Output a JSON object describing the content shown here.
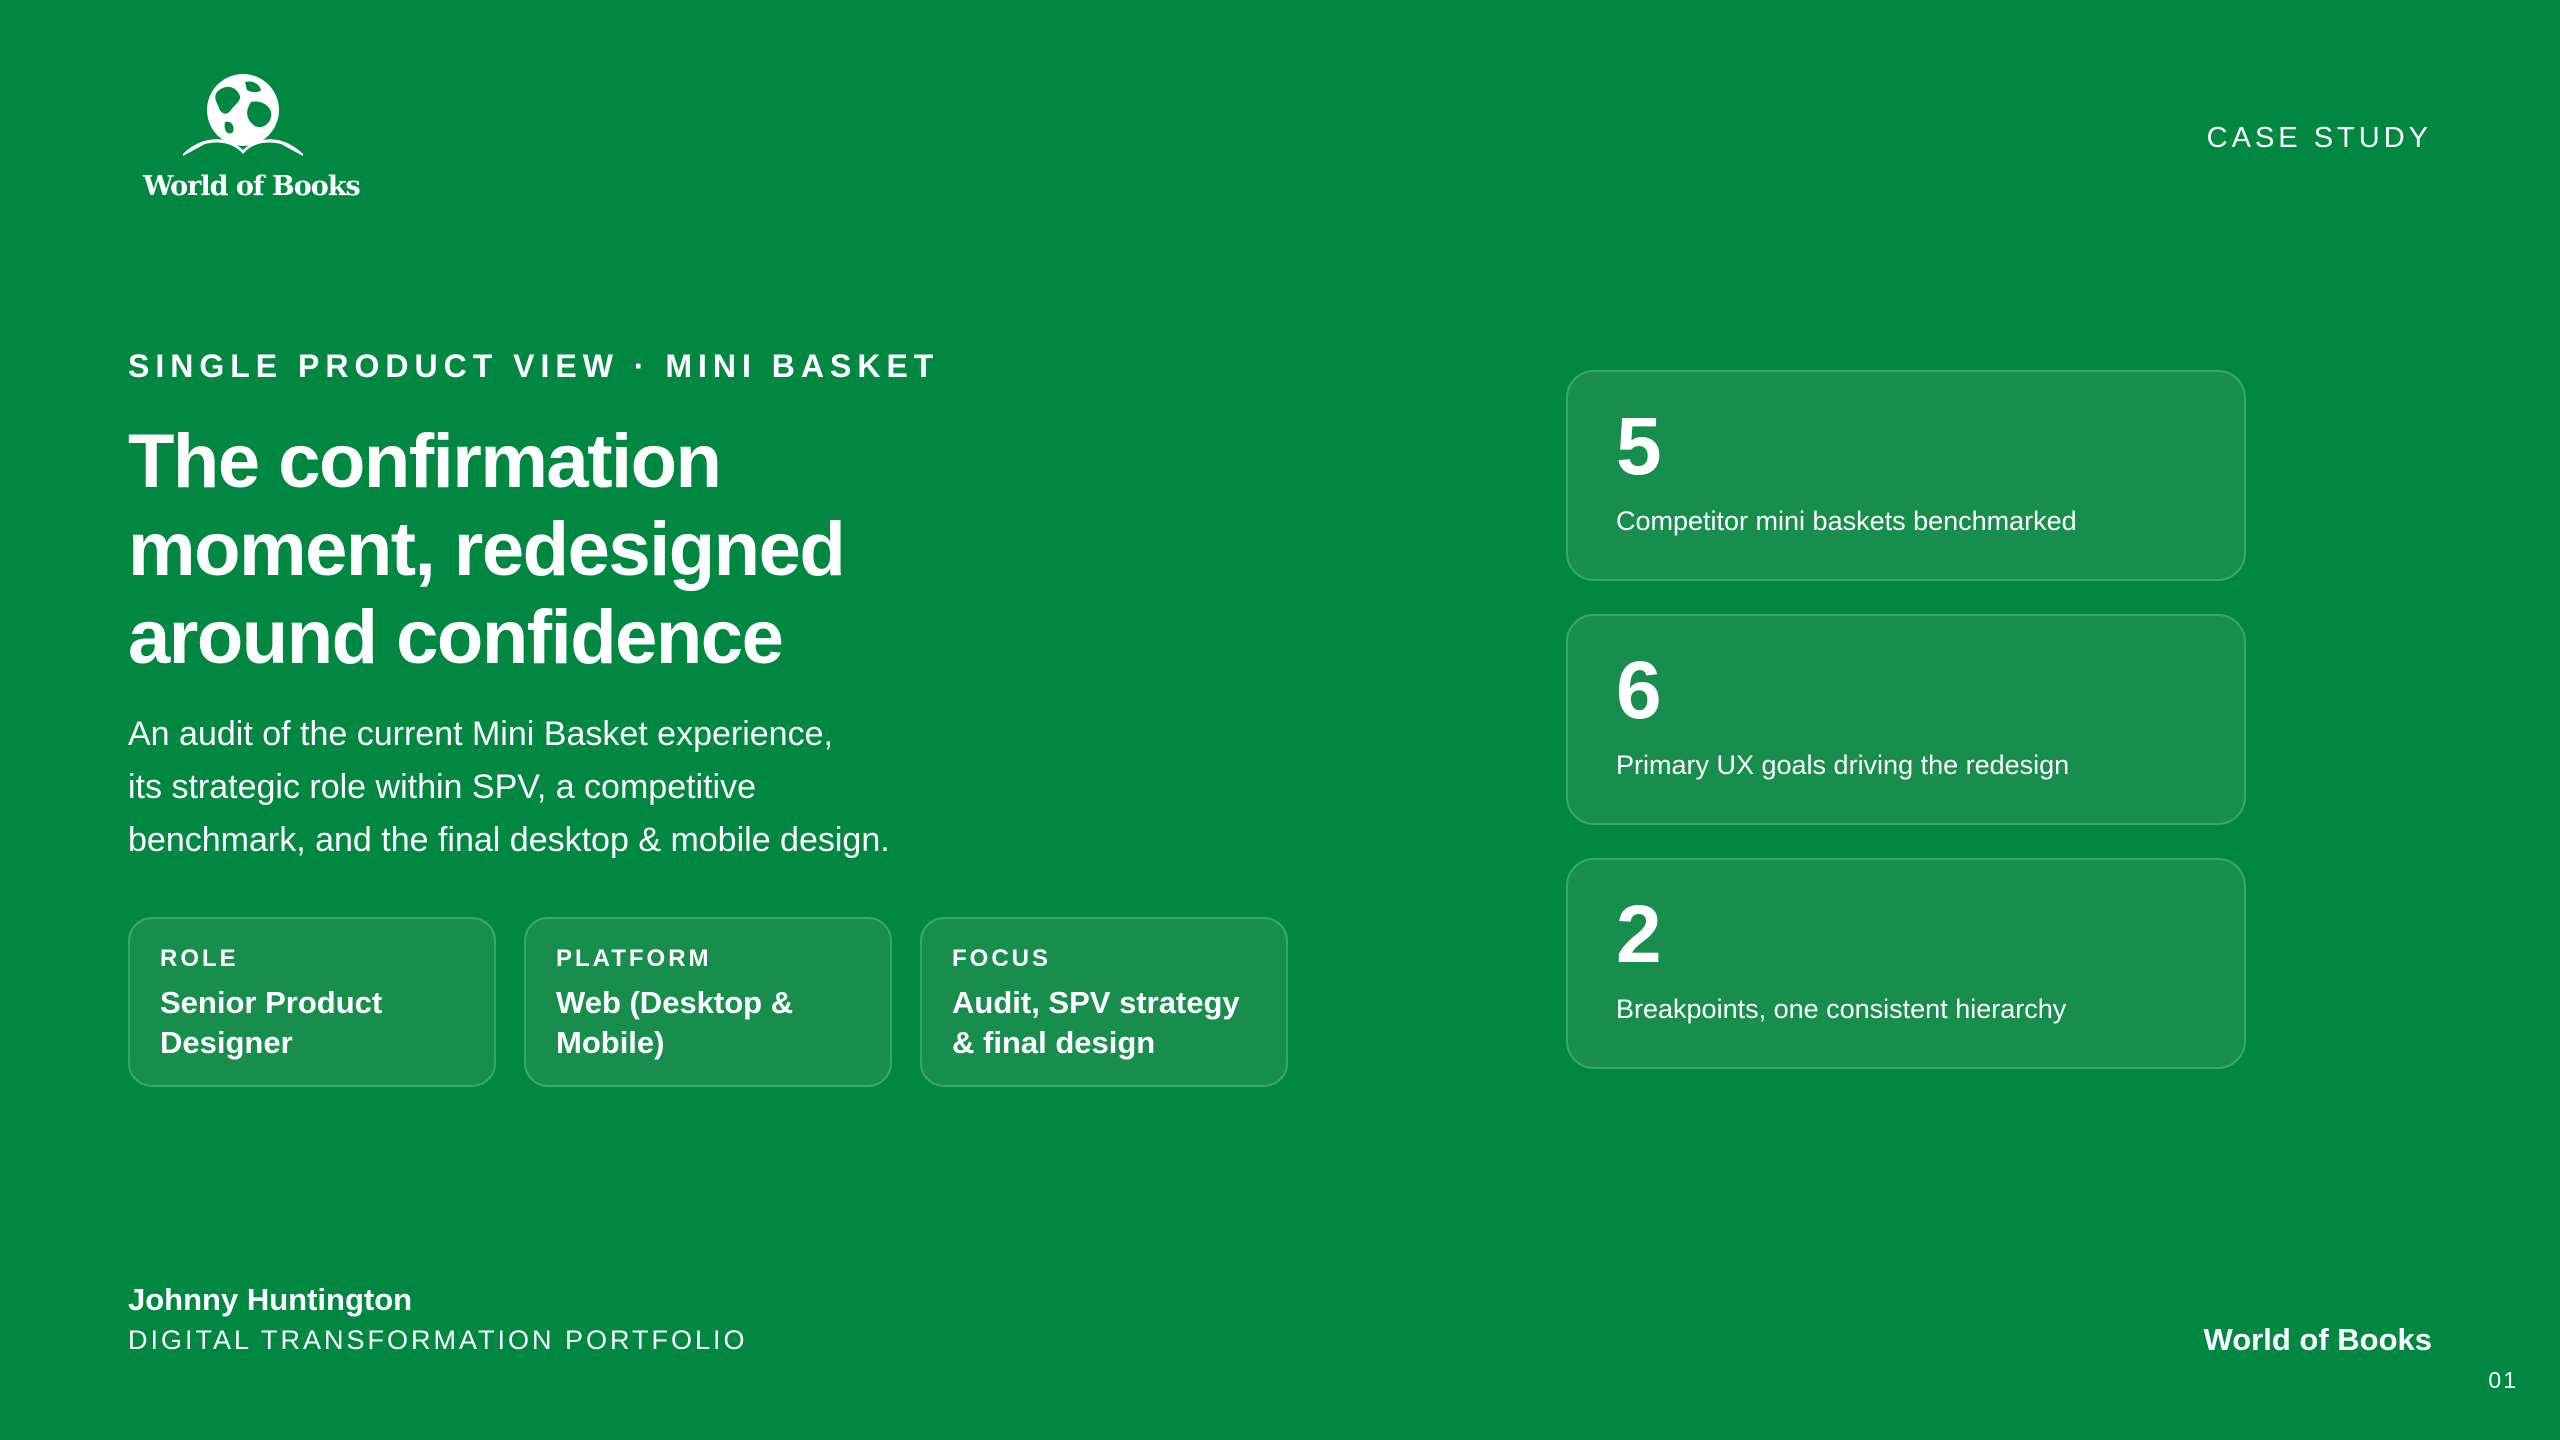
{
  "brand": {
    "logo_text": "World of Books",
    "logo_icon": "globe-book-icon"
  },
  "header": {
    "case_study": "CASE STUDY"
  },
  "hero": {
    "eyebrow": "SINGLE PRODUCT VIEW · MINI BASKET",
    "title_lines": [
      "The confirmation",
      "moment, redesigned",
      "around confidence"
    ],
    "description_lines": [
      "An audit of the current Mini Basket experience,",
      "its strategic role within SPV, a competitive",
      "benchmark, and the final desktop & mobile design."
    ]
  },
  "meta": [
    {
      "label": "ROLE",
      "value": "Senior Product Designer"
    },
    {
      "label": "PLATFORM",
      "value": "Web (Desktop & Mobile)"
    },
    {
      "label": "FOCUS",
      "value": "Audit, SPV strategy & final design"
    }
  ],
  "stats": [
    {
      "value": "5",
      "label": "Competitor mini baskets benchmarked"
    },
    {
      "value": "6",
      "label": "Primary UX goals driving the redesign"
    },
    {
      "value": "2",
      "label": "Breakpoints, one consistent hierarchy"
    }
  ],
  "footer": {
    "author": "Johnny Huntington",
    "portfolio": "DIGITAL TRANSFORMATION PORTFOLIO",
    "brand": "World of Books",
    "page_number": "01"
  },
  "colors": {
    "background": "#008843",
    "card": "#178e4e",
    "card_border": "#3ba66c",
    "text": "#ffffff"
  }
}
